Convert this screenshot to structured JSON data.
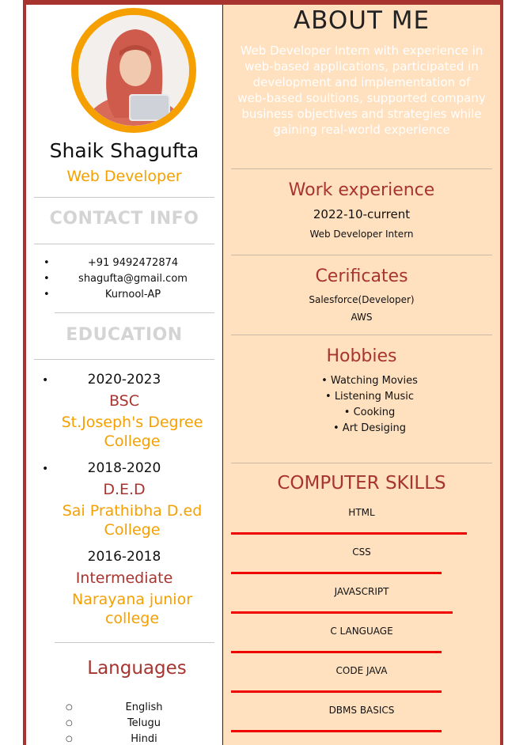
{
  "profile": {
    "name": "Shaik Shagufta",
    "title": "Web Developer",
    "photo_alt": "profile photo"
  },
  "contact": {
    "heading": "CONTACT INFO",
    "items": [
      "+91 9492472874",
      "shagufta@gmail.com",
      "Kurnool-AP"
    ]
  },
  "education": {
    "heading": "EDUCATION",
    "entries": [
      {
        "years": "2020-2023",
        "degree": "BSC",
        "college_line1": "St.Joseph's Degree",
        "college_line2": "College"
      },
      {
        "years": "2018-2020",
        "degree": "D.E.D",
        "college_line1": "Sai Prathibha D.ed",
        "college_line2": "College"
      },
      {
        "years": "2016-2018",
        "degree": "Intermediate",
        "college_line1": "Narayana junior",
        "college_line2": "college"
      }
    ]
  },
  "languages": {
    "heading": "Languages",
    "items": [
      "English",
      "Telugu",
      "Hindi"
    ]
  },
  "about": {
    "heading": "ABOUT ME",
    "lines": [
      "Web Developer Intern with experience in",
      "web-based applications, participated in",
      "development and implementation of",
      "web-based soultions, supported company",
      "business objectives and strategies while",
      "gaining real-world experience"
    ]
  },
  "work": {
    "heading": "Work experience",
    "period": "2022-10-current",
    "role": "Web Developer Intern"
  },
  "certificates": {
    "heading": "Cerificates",
    "items": [
      "Salesforce(Developer)",
      "AWS"
    ]
  },
  "hobbies": {
    "heading": "Hobbies",
    "items": [
      "Watching Movies",
      "Listening Music",
      "Cooking",
      "Art Desiging"
    ]
  },
  "skills": {
    "heading": "COMPUTER SKILLS",
    "items": [
      {
        "name": "HTML",
        "level": 0.85
      },
      {
        "name": "CSS",
        "level": 0.76
      },
      {
        "name": "JAVASCRIPT",
        "level": 0.8
      },
      {
        "name": "C LANGUAGE",
        "level": 0.76
      },
      {
        "name": "CODE JAVA",
        "level": 0.76
      },
      {
        "name": "DBMS BASICS",
        "level": 0.76
      }
    ]
  },
  "colors": {
    "accent_red": "#a8342f",
    "accent_orange": "#f5a000",
    "panel_peach": "#ffe0bf",
    "skill_bar": "#ee0000"
  }
}
